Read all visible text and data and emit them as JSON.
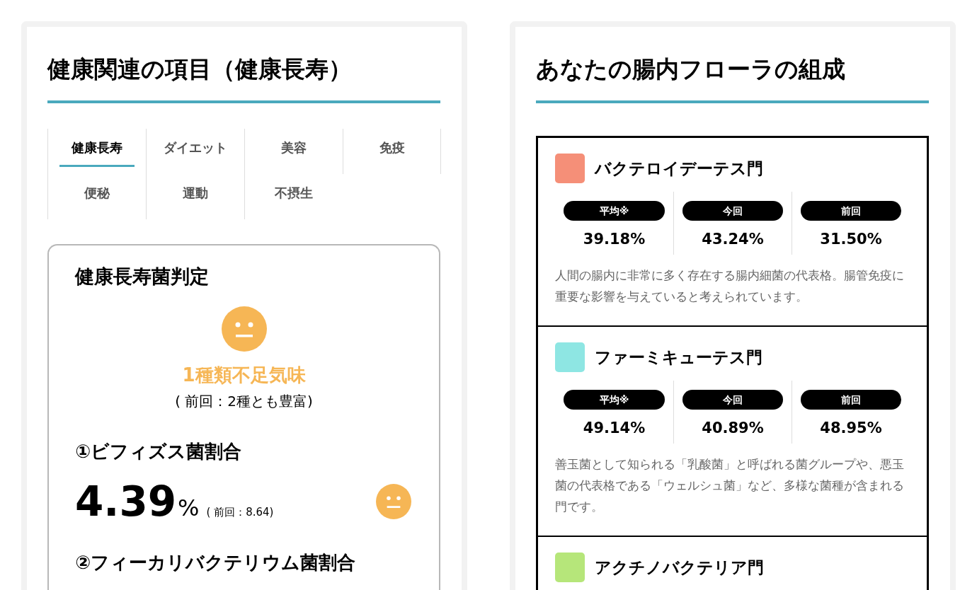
{
  "left": {
    "title": "健康関連の項目（健康長寿）",
    "tabs": [
      {
        "label": "健康長寿",
        "selected": true
      },
      {
        "label": "ダイエット",
        "selected": false
      },
      {
        "label": "美容",
        "selected": false
      },
      {
        "label": "免疫",
        "selected": false
      },
      {
        "label": "便秘",
        "selected": false
      },
      {
        "label": "運動",
        "selected": false
      },
      {
        "label": "不摂生",
        "selected": false
      }
    ],
    "judgement": {
      "title": "健康長寿菌判定",
      "result": "1種類不足気味",
      "previous": "( 前回：2種とも豊富)",
      "metrics": [
        {
          "title": "①ビフィズス菌割合",
          "value": "4.39",
          "unit": "%",
          "previous": "( 前回：8.64)"
        },
        {
          "title": "②フィーカリバクテリウム菌割合"
        }
      ]
    }
  },
  "right": {
    "title": "あなたの腸内フローラの組成",
    "phyla": [
      {
        "name": "バクテロイデーテス門",
        "color": "#f58f78",
        "stats": [
          {
            "label": "平均※",
            "value": "39.18%"
          },
          {
            "label": "今回",
            "value": "43.24%"
          },
          {
            "label": "前回",
            "value": "31.50%"
          }
        ],
        "description": "人間の腸内に非常に多く存在する腸内細菌の代表格。腸管免疫に重要な影響を与えていると考えられています。"
      },
      {
        "name": "ファーミキューテス門",
        "color": "#8ee6e3",
        "stats": [
          {
            "label": "平均※",
            "value": "49.14%"
          },
          {
            "label": "今回",
            "value": "40.89%"
          },
          {
            "label": "前回",
            "value": "48.95%"
          }
        ],
        "description": "善玉菌として知られる「乳酸菌」と呼ばれる菌グループや、悪玉菌の代表格である「ウェルシュ菌」など、多様な菌種が含まれる門です。"
      },
      {
        "name": "アクチノバクテリア門",
        "color": "#b6e67a"
      }
    ]
  }
}
